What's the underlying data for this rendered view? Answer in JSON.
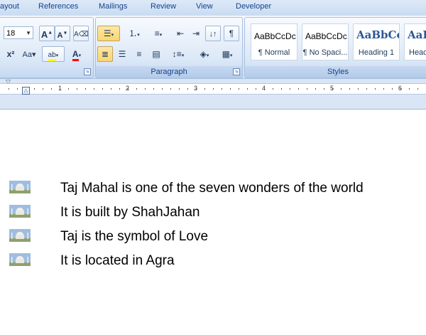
{
  "tabs": [
    "ayout",
    "References",
    "Mailings",
    "Review",
    "View",
    "Developer"
  ],
  "font": {
    "size": "18"
  },
  "groups": {
    "paragraph": "Paragraph",
    "styles": "Styles"
  },
  "styles": [
    {
      "sample": "AaBbCcDc",
      "name": "¶ Normal"
    },
    {
      "sample": "AaBbCcDc",
      "name": "¶ No Spaci..."
    },
    {
      "sample": "AaBbCc",
      "name": "Heading 1"
    },
    {
      "sample": "AaBbCc",
      "name": "Head"
    }
  ],
  "ruler": {
    "numbers": [
      "1",
      "2",
      "3",
      "4",
      "5",
      "6"
    ]
  },
  "document": {
    "lines": [
      "Taj Mahal is  one of the seven wonders of the world",
      "It is built by ShahJahan",
      "Taj is the symbol of Love",
      "It is located in Agra"
    ]
  },
  "colors": {
    "accent": "#15428b",
    "highlight": "#ffff00",
    "font_color": "#ff0000"
  }
}
